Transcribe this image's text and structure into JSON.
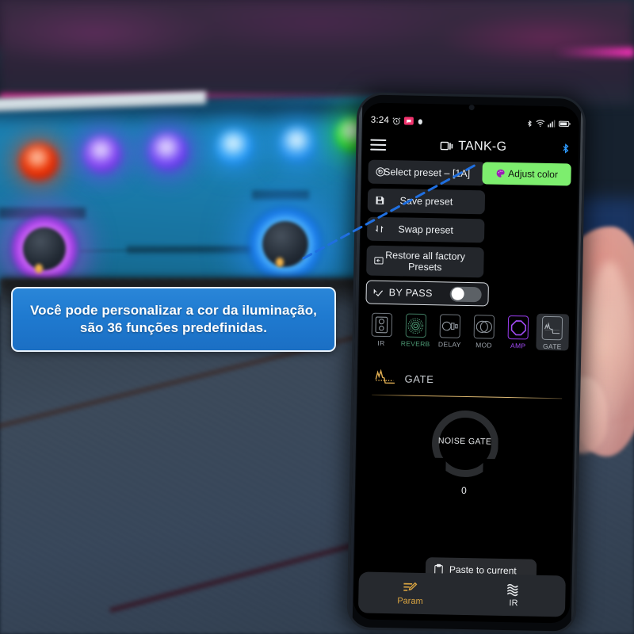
{
  "caption": {
    "text": "Você pode personalizar a cor da iluminação, são 36 funções predefinidas.",
    "line1": "Você pode personalizar a cor da iluminação,",
    "line2": "são 36 funções predefinidas.",
    "bg_color": "#1f7ad0",
    "border_color": "#eaf3fb",
    "text_color": "#ffffff"
  },
  "pointer": {
    "color": "#1f6fe0",
    "style": "dashed",
    "from_label": "glowing-knob-on-pedal",
    "to_label": "adjust-color-button"
  },
  "phone": {
    "status_bar": {
      "time": "3:24",
      "left_icons": [
        "alarm-clock-icon",
        "message-badge-icon",
        "app-icon"
      ],
      "right_icons": [
        "bluetooth-icon",
        "wifi-icon",
        "signal-icon",
        "battery-icon"
      ]
    },
    "app_bar": {
      "menu_icon": "hamburger-menu-icon",
      "device_icon": "device-cast-icon",
      "title": "TANK-G",
      "bluetooth_icon": "bluetooth-icon",
      "bluetooth_color": "#2e9bff"
    },
    "preset_buttons": [
      {
        "label": "Select preset – [1A]",
        "icon": "target-circle-icon"
      },
      {
        "label": "Save preset",
        "icon": "floppy-disk-icon"
      },
      {
        "label": "Swap preset",
        "icon": "swap-arrows-icon"
      },
      {
        "label": "Restore all factory",
        "label2": "Presets",
        "icon": "restore-box-icon"
      }
    ],
    "adjust_color": {
      "label": "Adjust color",
      "icon": "color-palette-icon",
      "bg_color": "#7dee6e",
      "text_color": "#10140f"
    },
    "bypass": {
      "label": "BY PASS",
      "icon": "check-arrow-icon",
      "toggle_state": "off"
    },
    "effects": [
      {
        "label": "IR",
        "icon": "speaker-cabinet-icon",
        "state": "normal",
        "color": "#9aa1a9"
      },
      {
        "label": "REVERB",
        "icon": "concentric-circles-icon",
        "state": "active",
        "color": "#4f9e78"
      },
      {
        "label": "DELAY",
        "icon": "delay-blocks-icon",
        "state": "normal",
        "color": "#9aa1a9"
      },
      {
        "label": "MOD",
        "icon": "overlapping-circles-icon",
        "state": "normal",
        "color": "#9aa1a9"
      },
      {
        "label": "AMP",
        "icon": "octagon-amp-icon",
        "state": "active",
        "color": "#a24bf5"
      },
      {
        "label": "GATE",
        "icon": "gate-waveform-icon",
        "state": "selected",
        "color": "#aeb4ba"
      }
    ],
    "section": {
      "title": "GATE",
      "icon": "gate-waveform-gold-icon",
      "accent_color": "#e4c07a"
    },
    "knob": {
      "label": "NOISE GATE",
      "value": "0",
      "track_color": "#2b2d30"
    },
    "paste_button": {
      "label": "Paste to current",
      "icon": "clipboard-icon"
    },
    "bottom_nav": [
      {
        "label": "Param",
        "icon": "sliders-pencil-icon",
        "active": true,
        "color": "#d9a441"
      },
      {
        "label": "IR",
        "icon": "waves-icon",
        "active": false,
        "color": "#e8eaec"
      }
    ]
  }
}
